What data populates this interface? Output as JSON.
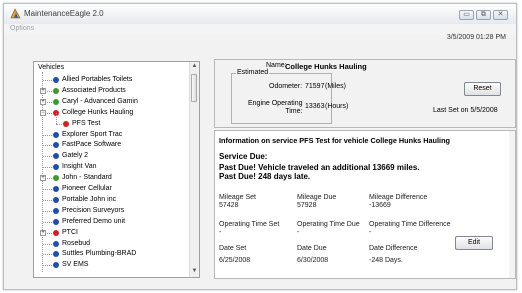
{
  "window": {
    "title": "MaintenanceEagle 2.0",
    "min_glyph": "▭",
    "max_glyph": "⧉",
    "close_glyph": "✕"
  },
  "menu": {
    "options_label": "Options"
  },
  "datetime": "3/5/2009 01:28 PM",
  "tree": {
    "root_label": "Vehicles",
    "items": [
      {
        "label": "Allied Portables Toilets",
        "expandable": false,
        "color": "#1f4fa8"
      },
      {
        "label": "Associated Products",
        "expandable": true,
        "color": "#3a9a2a"
      },
      {
        "label": "Caryl - Advanced Gamin",
        "expandable": true,
        "color": "#3a9a2a"
      },
      {
        "label": "College Hunks Hauling",
        "expandable": true,
        "expanded": true,
        "color": "#d02020"
      },
      {
        "label": "PFS Test",
        "child": true,
        "color": "#d02020"
      },
      {
        "label": "Explorer Sport Trac",
        "expandable": false,
        "color": "#1f4fa8"
      },
      {
        "label": "FastPace Software",
        "expandable": false,
        "color": "#1f4fa8"
      },
      {
        "label": "Gately 2",
        "expandable": false,
        "color": "#1f4fa8"
      },
      {
        "label": "Insight Van",
        "expandable": false,
        "color": "#1f4fa8"
      },
      {
        "label": "John - Standard",
        "expandable": true,
        "color": "#3a9a2a"
      },
      {
        "label": "Pioneer Cellular",
        "expandable": false,
        "color": "#1f4fa8"
      },
      {
        "label": "Portable John inc",
        "expandable": false,
        "color": "#1f4fa8"
      },
      {
        "label": "Precision Surveyors",
        "expandable": false,
        "color": "#1f4fa8"
      },
      {
        "label": "Preferred Demo unit",
        "expandable": false,
        "color": "#1f4fa8"
      },
      {
        "label": "PTCI",
        "expandable": true,
        "color": "#d02020"
      },
      {
        "label": "Rosebud",
        "expandable": false,
        "color": "#1f4fa8"
      },
      {
        "label": "Suttles Plumbing-BRAD",
        "expandable": false,
        "color": "#1f4fa8"
      },
      {
        "label": "SV EMS",
        "expandable": false,
        "color": "#1f4fa8"
      }
    ]
  },
  "vehicle": {
    "name_label": "Name:",
    "name_value": "College Hunks Hauling",
    "estimated_label": "Estimated",
    "odometer_label": "Odometer:",
    "odometer_value": "71597",
    "odometer_unit": "(Miles)",
    "engine_label_1": "Engine Operating",
    "engine_label_2": "Time:",
    "engine_value": "13363",
    "engine_unit": "(Hours)",
    "reset_label": "Reset",
    "last_set": "Last Set on 5/5/2008"
  },
  "info": {
    "title": "Information on service PFS Test for vehicle College Hunks Hauling",
    "service_due_label": "Service Due:",
    "due_line1": "Past Due! Vehicle traveled an additional 13669 miles.",
    "due_line2": "Past Due! 248 days late.",
    "mileage_set_label": "Mileage Set",
    "mileage_set_value": "57428",
    "mileage_due_label": "Mileage Due",
    "mileage_due_value": "57928",
    "mileage_diff_label": "Mileage Difference",
    "mileage_diff_value": "-13669",
    "op_time_set_label": "Operating Time Set",
    "op_time_set_value": "-",
    "op_time_due_label": "Operating Time Due",
    "op_time_due_value": "-",
    "op_time_diff_label": "Operating Time Difference",
    "op_time_diff_value": "-",
    "date_set_label": "Date Set",
    "date_set_value": "6/25/2008",
    "date_due_label": "Date Due",
    "date_due_value": "6/30/2008",
    "date_diff_label": "Date Difference",
    "date_diff_value": "-248 Days.",
    "edit_label": "Edit"
  }
}
